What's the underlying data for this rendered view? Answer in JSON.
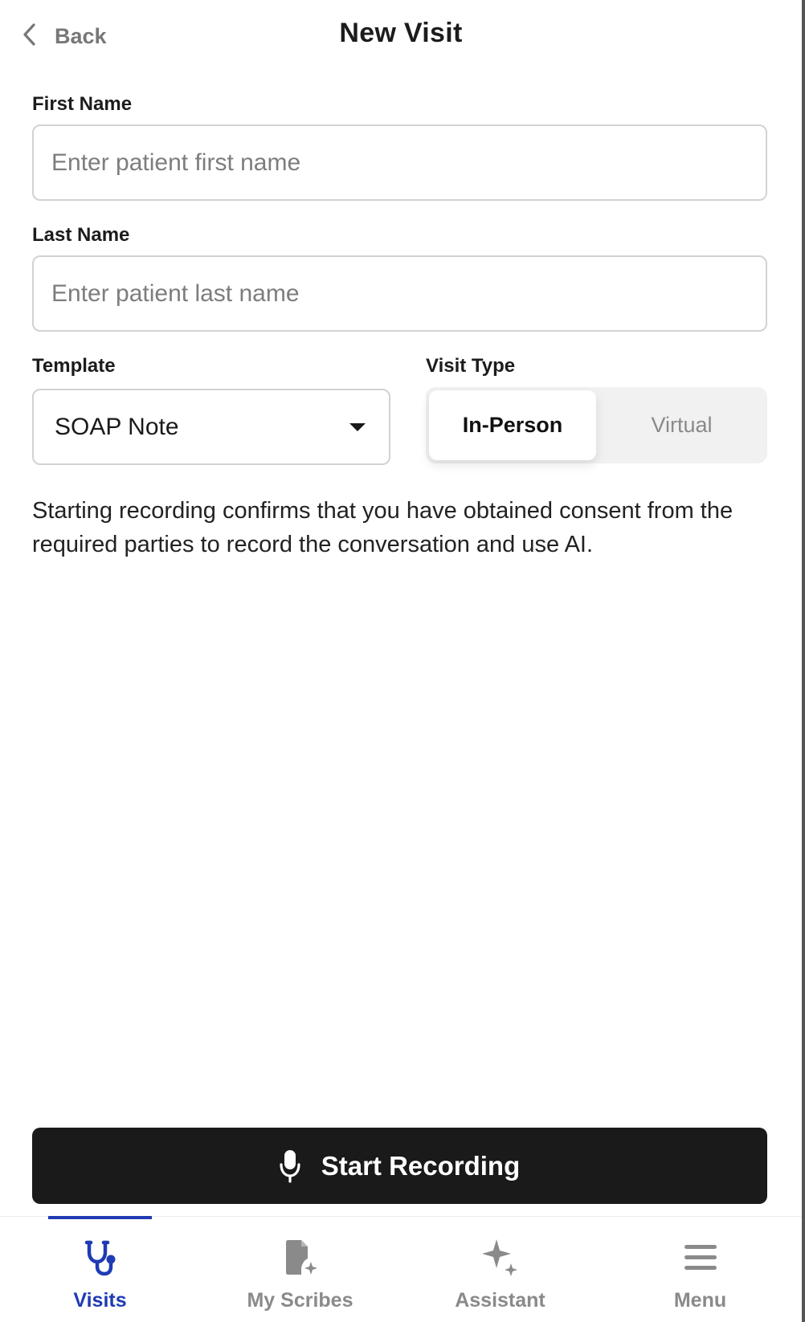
{
  "header": {
    "back_label": "Back",
    "title": "New Visit"
  },
  "form": {
    "first_name": {
      "label": "First Name",
      "placeholder": "Enter patient first name",
      "value": ""
    },
    "last_name": {
      "label": "Last Name",
      "placeholder": "Enter patient last name",
      "value": ""
    },
    "template": {
      "label": "Template",
      "selected": "SOAP Note"
    },
    "visit_type": {
      "label": "Visit Type",
      "options": [
        "In-Person",
        "Virtual"
      ],
      "selected": "In-Person"
    },
    "consent_text": "Starting recording confirms that you have obtained consent from the required parties to record the conversation and use AI."
  },
  "actions": {
    "start_recording_label": "Start Recording"
  },
  "bottom_nav": {
    "items": [
      {
        "label": "Visits",
        "icon": "stethoscope-icon",
        "active": true
      },
      {
        "label": "My Scribes",
        "icon": "document-sparkle-icon",
        "active": false
      },
      {
        "label": "Assistant",
        "icon": "sparkle-icon",
        "active": false
      },
      {
        "label": "Menu",
        "icon": "hamburger-menu-icon",
        "active": false
      }
    ]
  },
  "colors": {
    "accent": "#1f3bb3",
    "button_dark": "#1a1a1a",
    "muted_text": "#8a8a8a",
    "border": "#d2d2d2",
    "segment_bg": "#f1f1f1"
  }
}
